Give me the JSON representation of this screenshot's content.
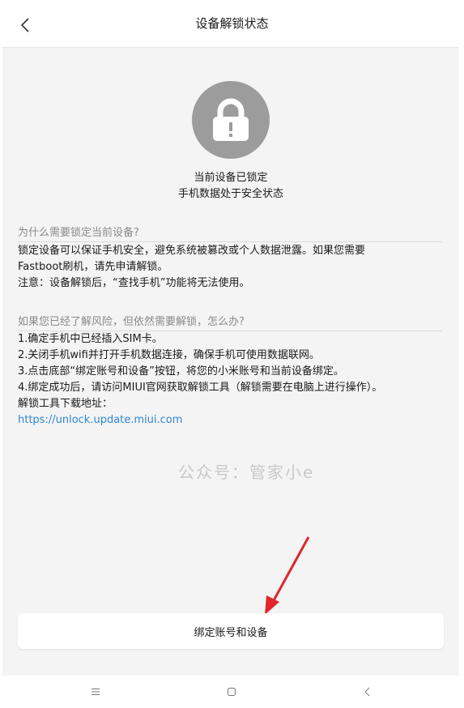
{
  "header": {
    "title": "设备解锁状态"
  },
  "status": {
    "line1": "当前设备已锁定",
    "line2": "手机数据处于安全状态"
  },
  "section1": {
    "title": "为什么需要锁定当前设备?",
    "lines": [
      "锁定设备可以保证手机安全，避免系统被篡改或个人数据泄露。如果您需要",
      "Fastboot刷机，请先申请解锁。",
      "注意：设备解锁后，“查找手机”功能将无法使用。"
    ]
  },
  "section2": {
    "title": "如果您已经了解风险，但依然需要解锁，怎么办?",
    "lines": [
      "1.确定手机中已经插入SIM卡。",
      "2.关闭手机wifi并打开手机数据连接，确保手机可使用数据联网。",
      "3.点击底部“绑定账号和设备”按钮，将您的小米账号和当前设备绑定。",
      "4.绑定成功后，请访问MIUI官网获取解锁工具（解锁需要在电脑上进行操作）。",
      "解锁工具下载地址："
    ],
    "link": "https://unlock.update.miui.com"
  },
  "watermark": "公众号：管家小e",
  "bind_button": {
    "label": "绑定账号和设备"
  },
  "icons": {
    "back": "chevron-left-icon",
    "lock": "lock-icon",
    "menu": "menu-icon",
    "home": "home-icon",
    "nav_back": "back-icon"
  },
  "colors": {
    "link": "#2f86d4",
    "lock_circle": "#9c9c9c",
    "arrow": "#e0262b",
    "background": "#f4f4f4"
  }
}
